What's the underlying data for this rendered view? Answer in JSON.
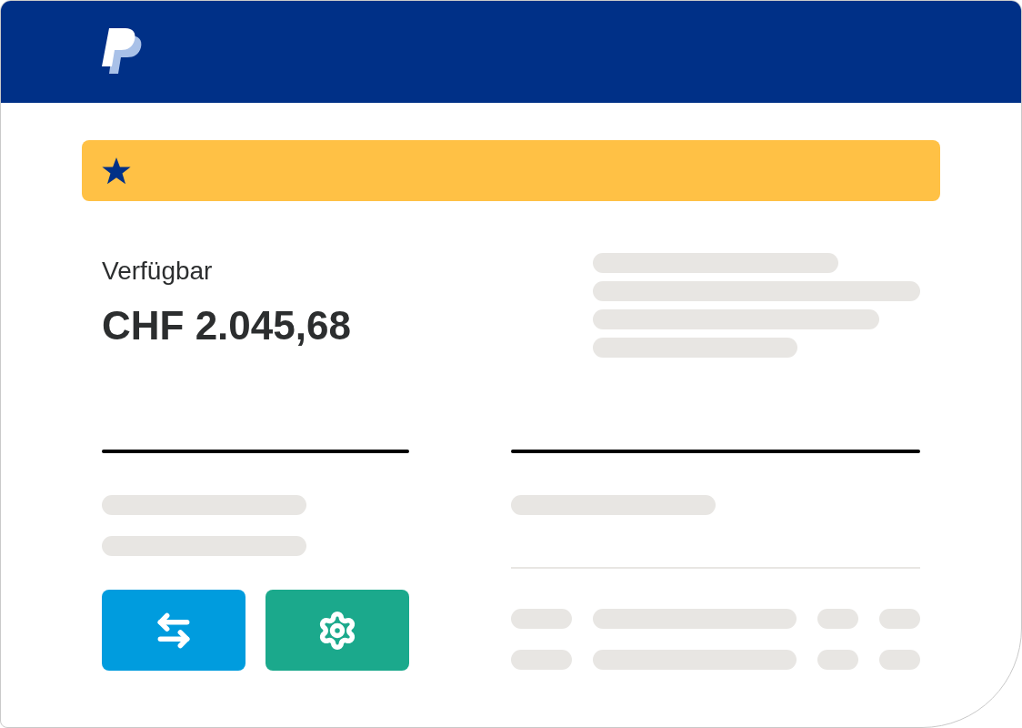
{
  "balance": {
    "label": "Verfügbar",
    "amount": "CHF 2.045,68"
  },
  "actions": [
    {
      "kind": "transfer"
    },
    {
      "kind": "settings"
    }
  ]
}
